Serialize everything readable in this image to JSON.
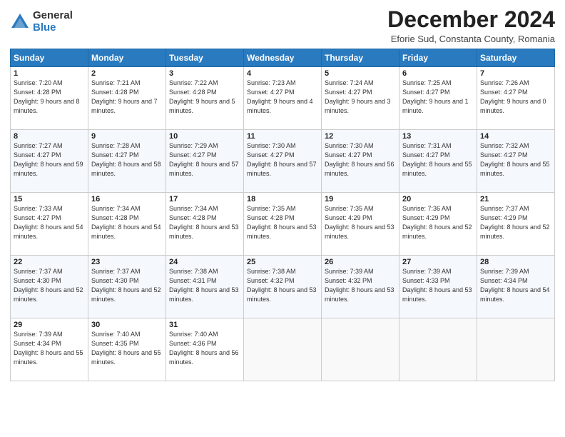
{
  "logo": {
    "general": "General",
    "blue": "Blue"
  },
  "title": "December 2024",
  "location": "Eforie Sud, Constanta County, Romania",
  "weekdays": [
    "Sunday",
    "Monday",
    "Tuesday",
    "Wednesday",
    "Thursday",
    "Friday",
    "Saturday"
  ],
  "weeks": [
    [
      {
        "day": "1",
        "sunrise": "Sunrise: 7:20 AM",
        "sunset": "Sunset: 4:28 PM",
        "daylight": "Daylight: 9 hours and 8 minutes."
      },
      {
        "day": "2",
        "sunrise": "Sunrise: 7:21 AM",
        "sunset": "Sunset: 4:28 PM",
        "daylight": "Daylight: 9 hours and 7 minutes."
      },
      {
        "day": "3",
        "sunrise": "Sunrise: 7:22 AM",
        "sunset": "Sunset: 4:28 PM",
        "daylight": "Daylight: 9 hours and 5 minutes."
      },
      {
        "day": "4",
        "sunrise": "Sunrise: 7:23 AM",
        "sunset": "Sunset: 4:27 PM",
        "daylight": "Daylight: 9 hours and 4 minutes."
      },
      {
        "day": "5",
        "sunrise": "Sunrise: 7:24 AM",
        "sunset": "Sunset: 4:27 PM",
        "daylight": "Daylight: 9 hours and 3 minutes."
      },
      {
        "day": "6",
        "sunrise": "Sunrise: 7:25 AM",
        "sunset": "Sunset: 4:27 PM",
        "daylight": "Daylight: 9 hours and 1 minute."
      },
      {
        "day": "7",
        "sunrise": "Sunrise: 7:26 AM",
        "sunset": "Sunset: 4:27 PM",
        "daylight": "Daylight: 9 hours and 0 minutes."
      }
    ],
    [
      {
        "day": "8",
        "sunrise": "Sunrise: 7:27 AM",
        "sunset": "Sunset: 4:27 PM",
        "daylight": "Daylight: 8 hours and 59 minutes."
      },
      {
        "day": "9",
        "sunrise": "Sunrise: 7:28 AM",
        "sunset": "Sunset: 4:27 PM",
        "daylight": "Daylight: 8 hours and 58 minutes."
      },
      {
        "day": "10",
        "sunrise": "Sunrise: 7:29 AM",
        "sunset": "Sunset: 4:27 PM",
        "daylight": "Daylight: 8 hours and 57 minutes."
      },
      {
        "day": "11",
        "sunrise": "Sunrise: 7:30 AM",
        "sunset": "Sunset: 4:27 PM",
        "daylight": "Daylight: 8 hours and 57 minutes."
      },
      {
        "day": "12",
        "sunrise": "Sunrise: 7:30 AM",
        "sunset": "Sunset: 4:27 PM",
        "daylight": "Daylight: 8 hours and 56 minutes."
      },
      {
        "day": "13",
        "sunrise": "Sunrise: 7:31 AM",
        "sunset": "Sunset: 4:27 PM",
        "daylight": "Daylight: 8 hours and 55 minutes."
      },
      {
        "day": "14",
        "sunrise": "Sunrise: 7:32 AM",
        "sunset": "Sunset: 4:27 PM",
        "daylight": "Daylight: 8 hours and 55 minutes."
      }
    ],
    [
      {
        "day": "15",
        "sunrise": "Sunrise: 7:33 AM",
        "sunset": "Sunset: 4:27 PM",
        "daylight": "Daylight: 8 hours and 54 minutes."
      },
      {
        "day": "16",
        "sunrise": "Sunrise: 7:34 AM",
        "sunset": "Sunset: 4:28 PM",
        "daylight": "Daylight: 8 hours and 54 minutes."
      },
      {
        "day": "17",
        "sunrise": "Sunrise: 7:34 AM",
        "sunset": "Sunset: 4:28 PM",
        "daylight": "Daylight: 8 hours and 53 minutes."
      },
      {
        "day": "18",
        "sunrise": "Sunrise: 7:35 AM",
        "sunset": "Sunset: 4:28 PM",
        "daylight": "Daylight: 8 hours and 53 minutes."
      },
      {
        "day": "19",
        "sunrise": "Sunrise: 7:35 AM",
        "sunset": "Sunset: 4:29 PM",
        "daylight": "Daylight: 8 hours and 53 minutes."
      },
      {
        "day": "20",
        "sunrise": "Sunrise: 7:36 AM",
        "sunset": "Sunset: 4:29 PM",
        "daylight": "Daylight: 8 hours and 52 minutes."
      },
      {
        "day": "21",
        "sunrise": "Sunrise: 7:37 AM",
        "sunset": "Sunset: 4:29 PM",
        "daylight": "Daylight: 8 hours and 52 minutes."
      }
    ],
    [
      {
        "day": "22",
        "sunrise": "Sunrise: 7:37 AM",
        "sunset": "Sunset: 4:30 PM",
        "daylight": "Daylight: 8 hours and 52 minutes."
      },
      {
        "day": "23",
        "sunrise": "Sunrise: 7:37 AM",
        "sunset": "Sunset: 4:30 PM",
        "daylight": "Daylight: 8 hours and 52 minutes."
      },
      {
        "day": "24",
        "sunrise": "Sunrise: 7:38 AM",
        "sunset": "Sunset: 4:31 PM",
        "daylight": "Daylight: 8 hours and 53 minutes."
      },
      {
        "day": "25",
        "sunrise": "Sunrise: 7:38 AM",
        "sunset": "Sunset: 4:32 PM",
        "daylight": "Daylight: 8 hours and 53 minutes."
      },
      {
        "day": "26",
        "sunrise": "Sunrise: 7:39 AM",
        "sunset": "Sunset: 4:32 PM",
        "daylight": "Daylight: 8 hours and 53 minutes."
      },
      {
        "day": "27",
        "sunrise": "Sunrise: 7:39 AM",
        "sunset": "Sunset: 4:33 PM",
        "daylight": "Daylight: 8 hours and 53 minutes."
      },
      {
        "day": "28",
        "sunrise": "Sunrise: 7:39 AM",
        "sunset": "Sunset: 4:34 PM",
        "daylight": "Daylight: 8 hours and 54 minutes."
      }
    ],
    [
      {
        "day": "29",
        "sunrise": "Sunrise: 7:39 AM",
        "sunset": "Sunset: 4:34 PM",
        "daylight": "Daylight: 8 hours and 55 minutes."
      },
      {
        "day": "30",
        "sunrise": "Sunrise: 7:40 AM",
        "sunset": "Sunset: 4:35 PM",
        "daylight": "Daylight: 8 hours and 55 minutes."
      },
      {
        "day": "31",
        "sunrise": "Sunrise: 7:40 AM",
        "sunset": "Sunset: 4:36 PM",
        "daylight": "Daylight: 8 hours and 56 minutes."
      },
      null,
      null,
      null,
      null
    ]
  ]
}
